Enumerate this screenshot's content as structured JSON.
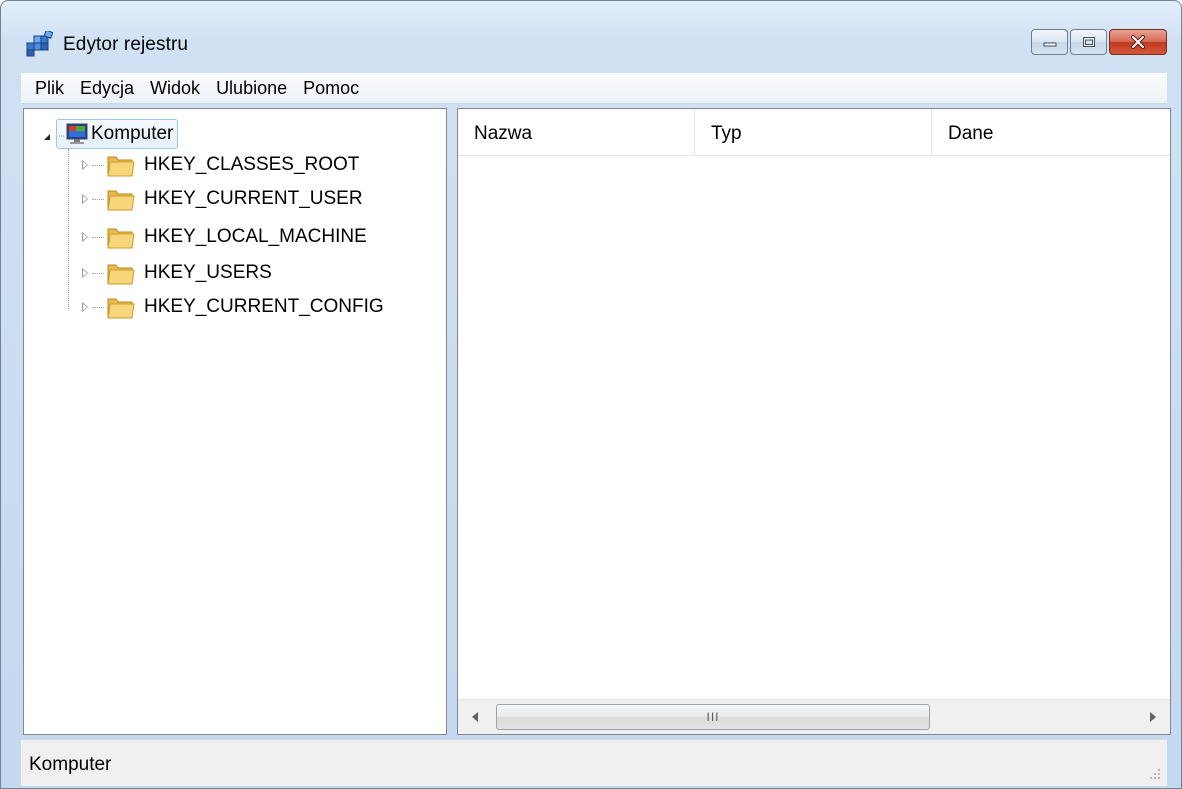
{
  "window": {
    "title": "Edytor rejestru",
    "icon": "regedit-icon"
  },
  "caption_buttons": [
    "minimize-icon",
    "maximize-icon",
    "close-icon"
  ],
  "menu": {
    "items": [
      {
        "label": "Plik"
      },
      {
        "label": "Edycja"
      },
      {
        "label": "Widok"
      },
      {
        "label": "Ulubione"
      },
      {
        "label": "Pomoc"
      }
    ]
  },
  "tree": {
    "root": {
      "label": "Komputer",
      "icon": "computer-icon",
      "expanded": true,
      "selected": true
    },
    "items": [
      {
        "label": "HKEY_CLASSES_ROOT",
        "icon": "folder-icon"
      },
      {
        "label": "HKEY_CURRENT_USER",
        "icon": "folder-icon"
      },
      {
        "label": "HKEY_LOCAL_MACHINE",
        "icon": "folder-icon"
      },
      {
        "label": "HKEY_USERS",
        "icon": "folder-icon"
      },
      {
        "label": "HKEY_CURRENT_CONFIG",
        "icon": "folder-icon"
      }
    ]
  },
  "list": {
    "columns": [
      {
        "label": "Nazwa"
      },
      {
        "label": "Typ"
      },
      {
        "label": "Dane"
      }
    ],
    "scrollbar_grip": "III"
  },
  "status": {
    "text": "Komputer"
  },
  "colors": {
    "frame": "#c4d8ef",
    "selection_border": "#99c8ec",
    "close_button": "#c13a1e"
  }
}
